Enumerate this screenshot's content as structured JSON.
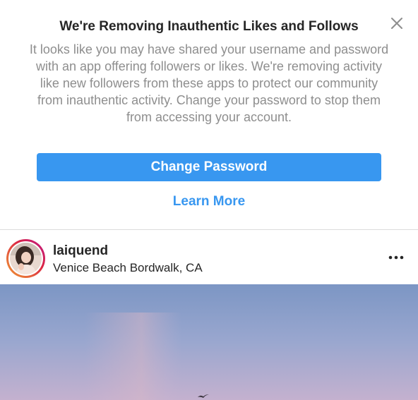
{
  "notice": {
    "title": "We're Removing Inauthentic Likes and Follows",
    "body": "It looks like you may have shared your username and password with an app offering followers or likes. We're removing activity like new followers from these apps to protect our community from inauthentic activity. Change your password to stop them from accessing your account.",
    "primary_button": "Change Password",
    "secondary_link": "Learn More",
    "close_icon": "close-icon",
    "accent_color": "#3897f0"
  },
  "post": {
    "username": "laiquend",
    "location": "Venice Beach Bordwalk, CA",
    "more_icon": "more-options-icon",
    "avatar_icon": "avatar"
  }
}
